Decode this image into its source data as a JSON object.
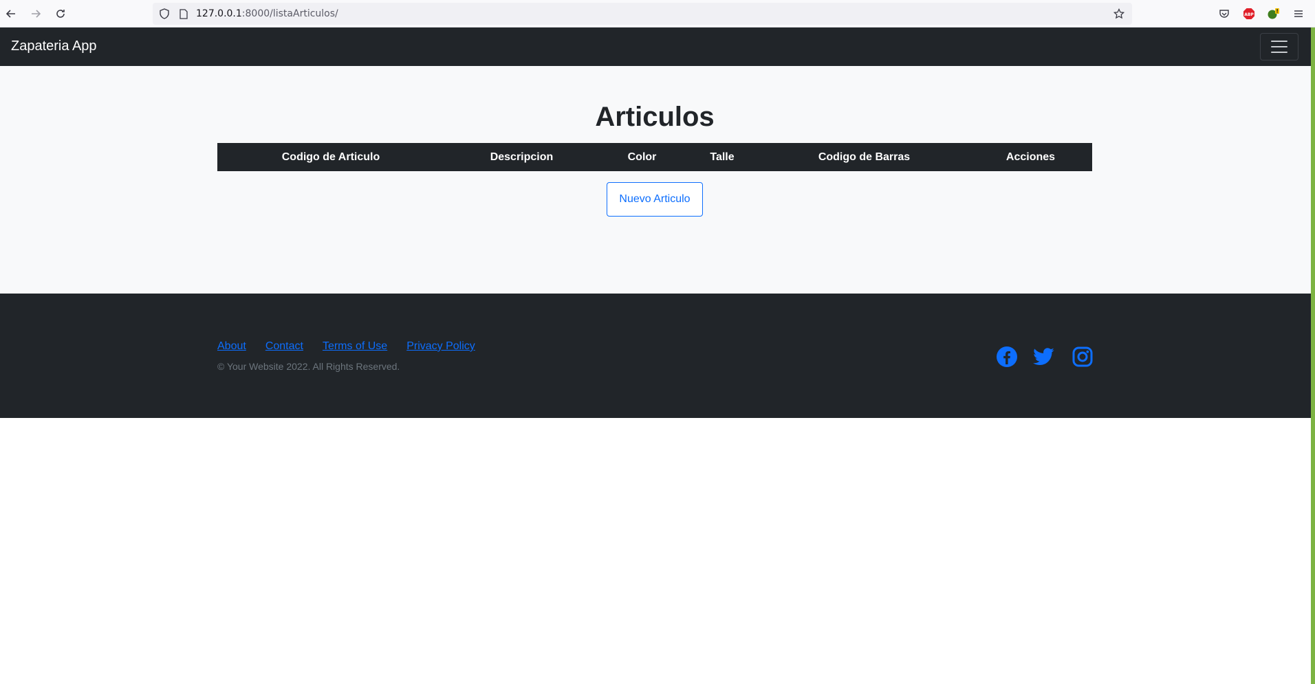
{
  "browser": {
    "url_host": "127.0.0.1",
    "url_rest": ":8000/listaArticulos/"
  },
  "navbar": {
    "brand": "Zapateria App"
  },
  "main": {
    "title": "Articulos",
    "table": {
      "headers": [
        "Codigo de Articulo",
        "Descripcion",
        "Color",
        "Talle",
        "Codigo de Barras",
        "Acciones"
      ]
    },
    "new_button": "Nuevo Articulo"
  },
  "footer": {
    "links": [
      "About",
      "Contact",
      "Terms of Use",
      "Privacy Policy"
    ],
    "copyright": "© Your Website 2022. All Rights Reserved.",
    "social": [
      "facebook-icon",
      "twitter-icon",
      "instagram-icon"
    ]
  },
  "colors": {
    "dark": "#212529",
    "primary": "#0d6efd",
    "light_bg": "#f8f9fa"
  }
}
